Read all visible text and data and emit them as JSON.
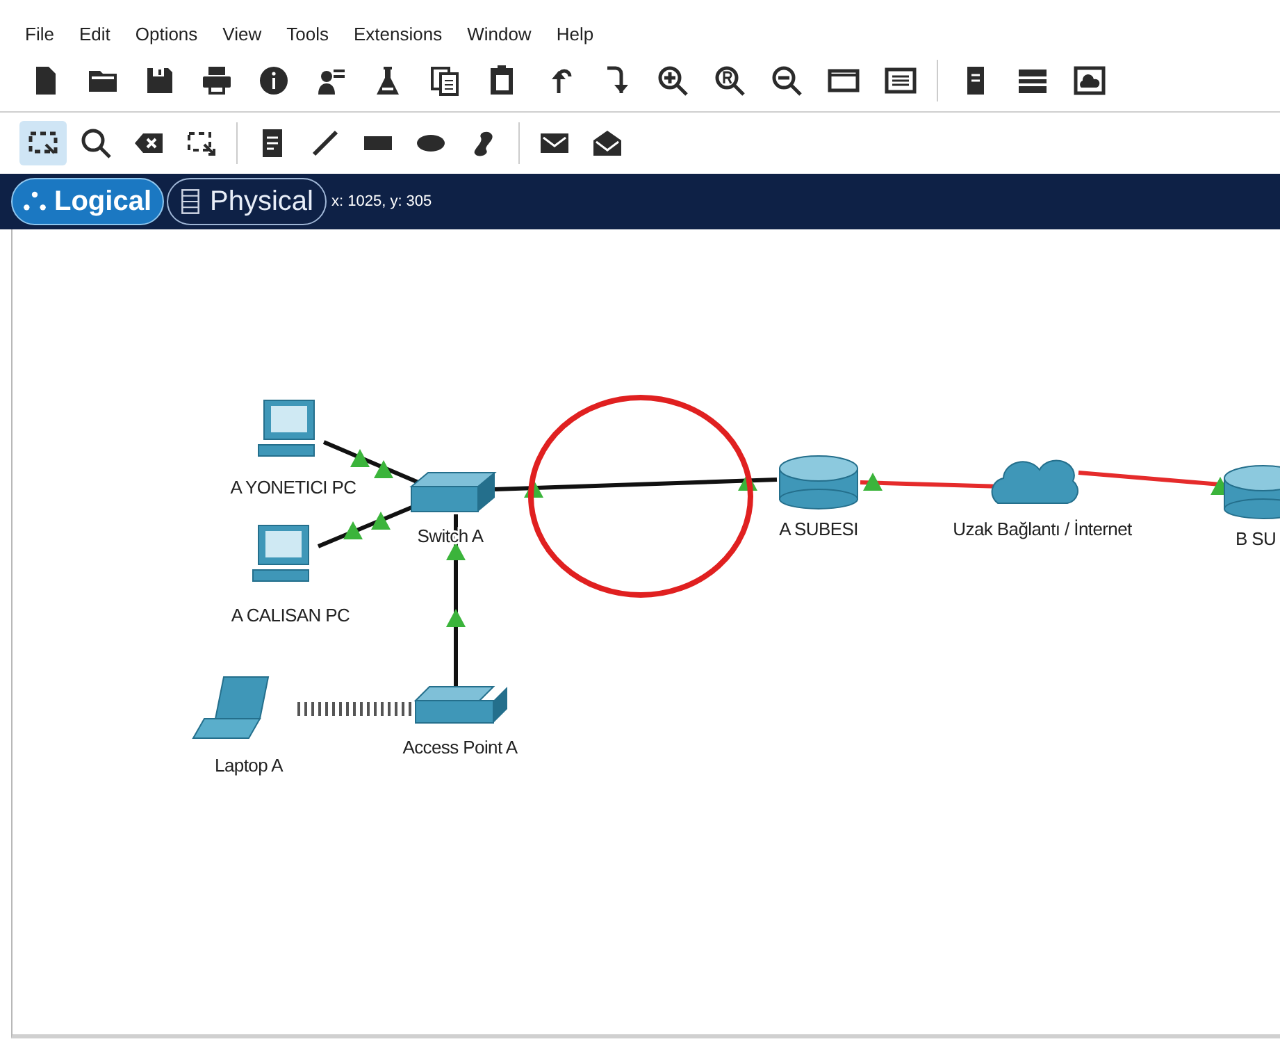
{
  "menu": [
    "File",
    "Edit",
    "Options",
    "View",
    "Tools",
    "Extensions",
    "Window",
    "Help"
  ],
  "toolbar_tools": [
    {
      "kind": "select",
      "selected": true
    },
    {
      "kind": "inspect",
      "selected": false
    },
    {
      "kind": "delete",
      "selected": false
    },
    {
      "kind": "resize",
      "selected": false
    },
    {
      "kind": "note",
      "selected": false
    },
    {
      "kind": "line",
      "selected": false
    },
    {
      "kind": "rectangle",
      "selected": false
    },
    {
      "kind": "ellipse",
      "selected": false
    },
    {
      "kind": "freeform",
      "selected": false
    },
    {
      "kind": "simple-pdu",
      "selected": false
    },
    {
      "kind": "complex-pdu",
      "selected": false
    }
  ],
  "view_tabs": [
    {
      "label": "Logical",
      "selected": true
    },
    {
      "label": "Physical",
      "selected": false
    }
  ],
  "cursor_position": "x: 1025, y: 305",
  "devices": [
    {
      "kind": "pc",
      "label": "A YONETICI PC"
    },
    {
      "kind": "pc",
      "label": "A CALISAN PC"
    },
    {
      "kind": "switch",
      "label": "Switch A"
    },
    {
      "kind": "laptop",
      "label": "Laptop A"
    },
    {
      "kind": "access-point",
      "label": "Access Point A"
    },
    {
      "kind": "router",
      "label": "A SUBESI"
    },
    {
      "kind": "cloud",
      "label": "Uzak Bağlantı / İnternet"
    },
    {
      "kind": "router",
      "label": "B SU"
    }
  ],
  "links": [
    {
      "kind": "copper",
      "from_up": true,
      "to_up": true
    },
    {
      "kind": "copper",
      "from_up": true,
      "to_up": true
    },
    {
      "kind": "copper",
      "from_up": true,
      "to_up": true
    },
    {
      "kind": "wireless"
    },
    {
      "kind": "copper",
      "from_up": true,
      "to_up": true
    },
    {
      "kind": "serial",
      "from_up": true
    },
    {
      "kind": "serial",
      "to_up": true
    }
  ],
  "annotation": {
    "kind": "circle",
    "color": "#e02020"
  }
}
